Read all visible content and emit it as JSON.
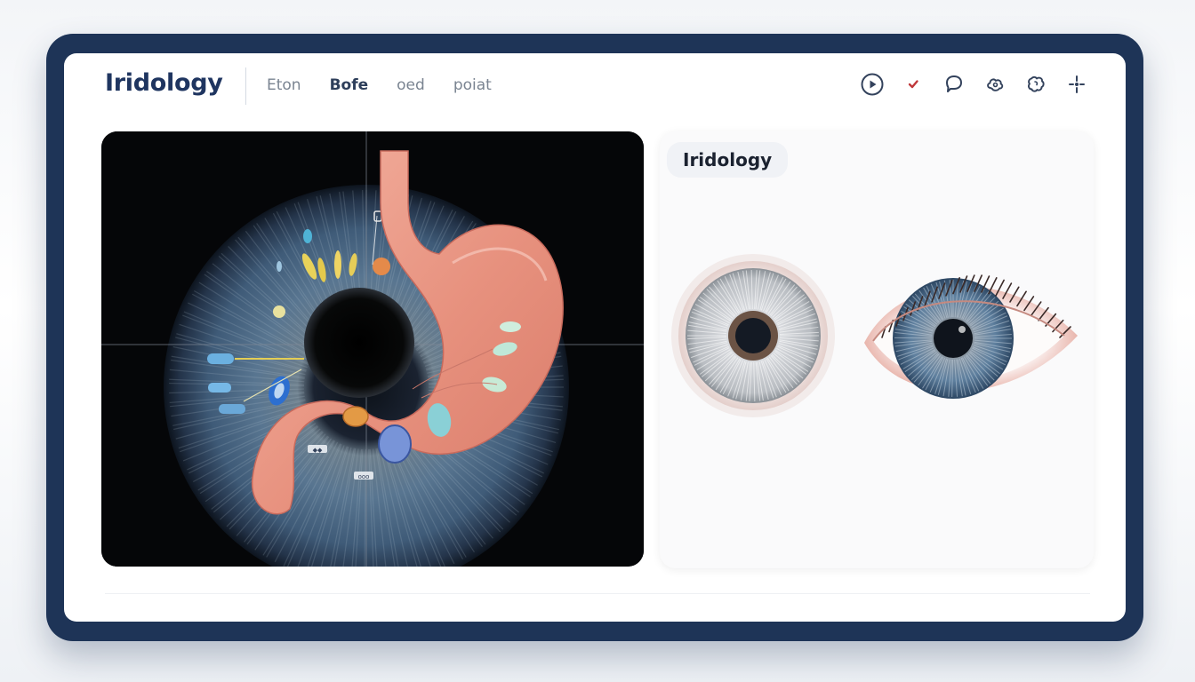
{
  "app": {
    "title": "Iridology"
  },
  "nav": {
    "items": [
      "Eton",
      "Bofe",
      "oed",
      "poiat"
    ],
    "active_index": 1
  },
  "toolbar": {
    "icons": [
      "play-circle-icon",
      "check-icon",
      "chat-bubble-icon",
      "cloud-flower-icon",
      "brain-icon",
      "sparkle-icon"
    ],
    "check_color": "#c0383a",
    "icon_color": "#33425c"
  },
  "left_panel": {
    "tags": [
      "◆◆",
      "ooo"
    ]
  },
  "right_panel": {
    "label": "Iridology"
  },
  "colors": {
    "frame": "#1e3457",
    "title": "#1f3560",
    "stomach": "#e89a86",
    "iris": "#5a7897"
  }
}
